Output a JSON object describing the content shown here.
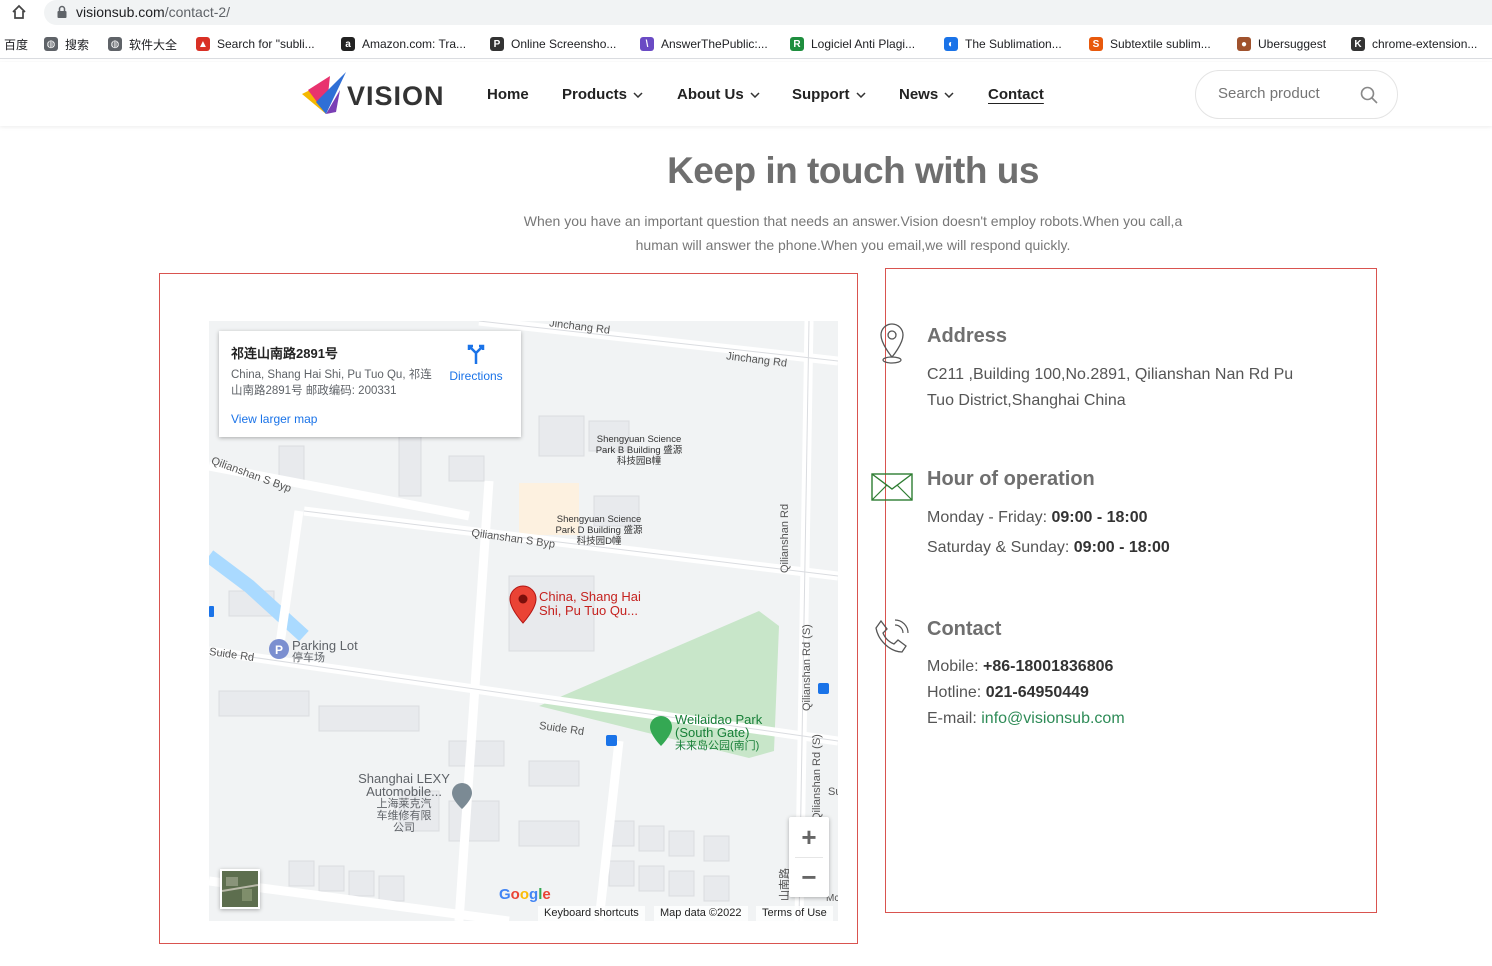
{
  "browser": {
    "url_host": "visionsub.com",
    "url_path": "/contact-2/",
    "bookmarks": [
      {
        "label": "百度",
        "icon": "baidu-icon",
        "color": "#2932e1"
      },
      {
        "label": "搜索",
        "icon": "globe-icon",
        "color": "#5f6368"
      },
      {
        "label": "软件大全",
        "icon": "globe-icon",
        "color": "#5f6368"
      },
      {
        "label": "Search for \"subli...",
        "icon": "flame-icon",
        "color": "#d93025"
      },
      {
        "label": "Amazon.com: Tra...",
        "icon": "amazon-icon",
        "color": "#222222"
      },
      {
        "label": "Online Screensho...",
        "icon": "p-icon",
        "color": "#333333"
      },
      {
        "label": "AnswerThePublic:...",
        "icon": "answerthepublic-icon",
        "color": "#6a4bc4"
      },
      {
        "label": "Logiciel Anti Plagi...",
        "icon": "pr-icon",
        "color": "#1e8e3e"
      },
      {
        "label": "The Sublimation...",
        "icon": "sublimation-icon",
        "color": "#1a73e8"
      },
      {
        "label": "Subtextile sublim...",
        "icon": "subtextile-icon",
        "color": "#e8590c"
      },
      {
        "label": "Ubersuggest",
        "icon": "avatar-icon",
        "color": "#a0522d"
      },
      {
        "label": "chrome-extension...",
        "icon": "k-icon",
        "color": "#333333"
      }
    ]
  },
  "site": {
    "logo_text": "VISION",
    "nav": [
      {
        "label": "Home",
        "dropdown": false
      },
      {
        "label": "Products",
        "dropdown": true
      },
      {
        "label": "About Us",
        "dropdown": true
      },
      {
        "label": "Support",
        "dropdown": true
      },
      {
        "label": "News",
        "dropdown": true
      },
      {
        "label": "Contact",
        "dropdown": false,
        "active": true
      }
    ],
    "search_placeholder": "Search product"
  },
  "intro": {
    "headline": "Keep in touch with us",
    "text_line1": "When you have an important question that needs an answer.Vision doesn't employ robots.When you call,a",
    "text_line2": "human will answer the phone.When you email,we will respond quickly."
  },
  "map": {
    "card_title": "祁连山南路2891号",
    "card_address": "China, Shang Hai Shi, Pu Tuo Qu, 祁连山南路2891号 邮政编码: 200331",
    "directions_label": "Directions",
    "larger_map_label": "View larger map",
    "labels": {
      "jinchang_top": "Jinchang Rd",
      "jinchang": "Jinchang Rd",
      "qilianshan_byp_left": "Qilianshan S Byp",
      "qilianshan_byp": "Qilianshan S Byp",
      "qilianshan_rd": "Qilianshan Rd",
      "qilianshan_rd_s1": "Qilianshan Rd (S)",
      "qilianshan_rd_s2": "Qilianshan Rd (S)",
      "suide_left": "Suide Rd",
      "suide": "Suide Rd",
      "park_b": "Shengyuan Science Park B Building 盛源科技园B幢",
      "park_d": "Shengyuan Science Park D Building 盛源科技园D幢",
      "pin": "China, Shang Hai Shi, Pu Tuo Qu...",
      "parking": "Parking Lot",
      "parking_cn": "停车场",
      "weilaidao": "Weilaidao Park (South Gate)",
      "weilaidao_cn": "未来岛公园(南门)",
      "lexy": "Shanghai LEXY Automobile...",
      "lexy_cn": "上海莱克汽车维修有限公司",
      "cn_road": "山南路",
      "edge_su": "Su",
      "edge_mo": "Mc"
    },
    "zoom_in": "+",
    "zoom_out": "−",
    "google_letters": [
      "G",
      "o",
      "o",
      "g",
      "l",
      "e"
    ],
    "footer": {
      "shortcuts": "Keyboard shortcuts",
      "mapdata": "Map data ©2022",
      "terms": "Terms of Use"
    }
  },
  "info": {
    "address_title": "Address",
    "address_line1": "C211 ,Building 100,No.2891, Qilianshan Nan Rd Pu",
    "address_line2": "Tuo District,Shanghai China",
    "hours_title": "Hour of operation",
    "weekday_label": "Monday - Friday: ",
    "weekday_hours": "09:00 - 18:00",
    "weekend_label": "Saturday & Sunday: ",
    "weekend_hours": "09:00 - 18:00",
    "contact_title": "Contact",
    "mobile_label": "Mobile: ",
    "mobile": "+86-18001836806",
    "hotline_label": "Hotline: ",
    "hotline": "021-64950449",
    "email_label": "E-mail: ",
    "email": "info@visionsub.com"
  },
  "colors": {
    "accent_red": "#d9534f",
    "heading_gray": "#6f6f6f",
    "link_green": "#2e8b57",
    "map_blue": "#1a73e8"
  }
}
